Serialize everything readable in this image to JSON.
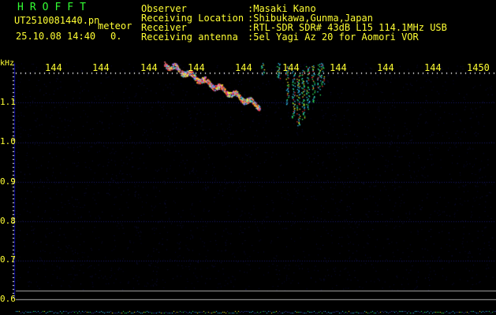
{
  "app": {
    "title": "HROFFT"
  },
  "header": {
    "file_name": "UT2510081440.pn",
    "meteor_label": "meteor",
    "datetime": "25.10.08 14:40",
    "meteor_count": "0.",
    "info_rows": [
      {
        "label": "Observer",
        "value": ":Masaki Kano"
      },
      {
        "label": "Receiving Location",
        "value": ":Shibukawa,Gunma,Japan"
      },
      {
        "label": "Receiver",
        "value": ":RTL-SDR SDR# 43dB L15 114.1MHz USB"
      },
      {
        "label": "Receiving antenna",
        "value": ":5el Yagi Az 20 for Aomori VOR"
      }
    ]
  },
  "plot": {
    "unit_label": "kHz",
    "y_ticks": [
      "1.1",
      "1.0",
      "0.9",
      "0.8",
      "0.7",
      "0.6"
    ],
    "x_ticks": [
      "144",
      "144",
      "144",
      "144",
      "144",
      "144",
      "144",
      "144",
      "144",
      "1450"
    ],
    "colors": {
      "frame": "#0000aa",
      "grid": "#1a1a66",
      "tick": "#ffffff",
      "trace_hot": "#ff3333",
      "trace_mid": "#ffff33",
      "trace_cool": "#33ccff",
      "trace_green": "#33ff66",
      "baseline": "#aaaaaa"
    }
  }
}
